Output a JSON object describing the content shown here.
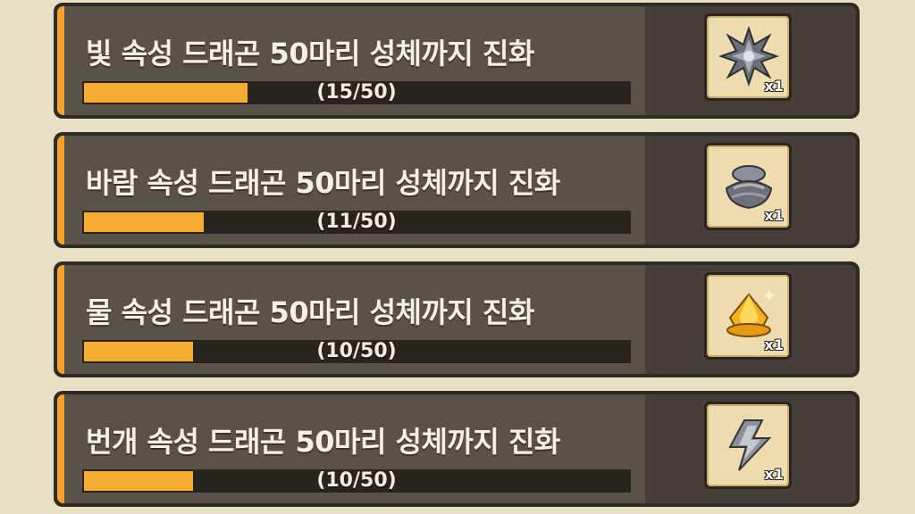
{
  "quests": [
    {
      "title": "빛 속성 드래곤 50마리 성체까지 진화",
      "progress_text": "(15/50)",
      "progress_fraction": 0.3,
      "reward_icon": "light-crystal-icon",
      "reward_count": "x1"
    },
    {
      "title": "바람 속성 드래곤 50마리 성체까지 진화",
      "progress_text": "(11/50)",
      "progress_fraction": 0.22,
      "reward_icon": "wind-stone-icon",
      "reward_count": "x1"
    },
    {
      "title": "물 속성 드래곤 50마리 성체까지 진화",
      "progress_text": "(10/50)",
      "progress_fraction": 0.2,
      "reward_icon": "gold-gem-icon",
      "reward_count": "x1"
    },
    {
      "title": "번개 속성 드래곤 50마리 성체까지 진화",
      "progress_text": "(10/50)",
      "progress_fraction": 0.2,
      "reward_icon": "lightning-stone-icon",
      "reward_count": "x1"
    }
  ],
  "colors": {
    "accent": "#f3a32c",
    "bar_fill": "#f5ab2f",
    "panel": "#5a5147"
  }
}
